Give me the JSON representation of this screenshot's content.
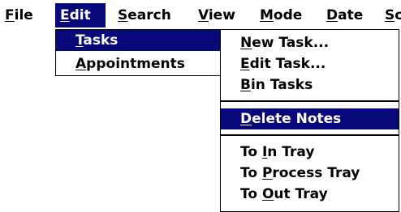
{
  "menubar": {
    "items": [
      {
        "acc": "F",
        "rest": "ile"
      },
      {
        "acc": "E",
        "rest": "dit"
      },
      {
        "acc": "S",
        "rest": "earch"
      },
      {
        "acc": "V",
        "rest": "iew"
      },
      {
        "acc": "M",
        "rest": "ode"
      },
      {
        "acc": "D",
        "rest": "ate"
      },
      {
        "acc": "S",
        "rest": "c"
      }
    ],
    "active_index": 1
  },
  "edit_menu": {
    "items": [
      {
        "acc": "T",
        "rest": "asks",
        "highlighted": true
      },
      {
        "acc": "A",
        "rest": "ppointments",
        "highlighted": false
      }
    ]
  },
  "tasks_menu": {
    "items": [
      {
        "acc": "N",
        "rest": "ew Task..."
      },
      {
        "acc": "E",
        "rest": "dit Task..."
      },
      {
        "acc": "B",
        "rest": "in Tasks"
      },
      {
        "acc": "D",
        "rest": "elete Notes"
      },
      {
        "pre": "To ",
        "acc": "I",
        "rest": "n Tray"
      },
      {
        "pre": "To ",
        "acc": "P",
        "rest": "rocess Tray"
      },
      {
        "pre": "To ",
        "acc": "O",
        "rest": "ut Tray"
      }
    ],
    "highlighted_index": 3
  },
  "colors": {
    "highlight_bg": "#08087a",
    "highlight_fg": "#ffffff",
    "background": "#ffffff",
    "text": "#000000"
  }
}
